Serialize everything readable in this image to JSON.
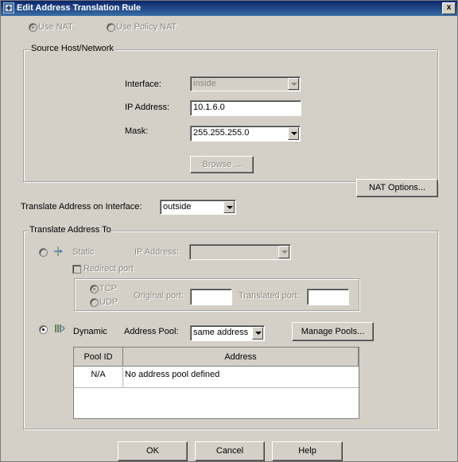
{
  "window": {
    "title": "Edit Address Translation Rule",
    "close": "x"
  },
  "nat_mode": {
    "use_nat": "Use NAT",
    "use_policy_nat": "Use Policy NAT"
  },
  "source": {
    "group_label": "Source Host/Network",
    "interface_label": "Interface:",
    "interface_value": "inside",
    "ip_label": "IP Address:",
    "ip_value": "10.1.6.0",
    "mask_label": "Mask:",
    "mask_value": "255.255.255.0",
    "browse_button": "Browse ..."
  },
  "nat_options_button": "NAT Options...",
  "translate_on": {
    "label": "Translate Address on Interface:",
    "value": "outside"
  },
  "translate_to": {
    "group_label": "Translate Address To",
    "static": {
      "label": "Static",
      "ip_label": "IP Address:",
      "ip_value": "",
      "redirect_port": "Redirect port",
      "tcp": "TCP",
      "udp": "UDP",
      "original_port_label": "Original port:",
      "original_port_value": "",
      "translated_port_label": "Translated port:",
      "translated_port_value": ""
    },
    "dynamic": {
      "label": "Dynamic",
      "pool_label": "Address Pool:",
      "pool_value": "same address",
      "manage_button": "Manage Pools..."
    },
    "table": {
      "headers": [
        "Pool ID",
        "Address"
      ],
      "rows": [
        [
          "N/A",
          "No address pool defined"
        ]
      ]
    }
  },
  "footer": {
    "ok": "OK",
    "cancel": "Cancel",
    "help": "Help"
  },
  "colors": {
    "title_bar": "#0a246a",
    "dialog_bg": "#d4d0c8"
  }
}
